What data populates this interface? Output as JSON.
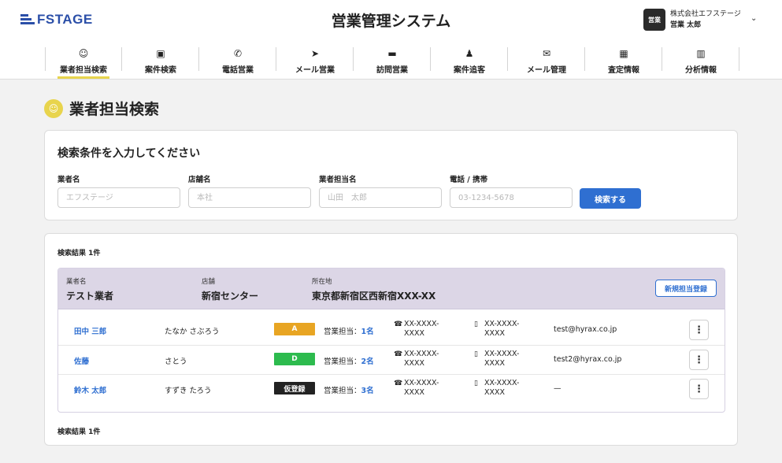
{
  "header": {
    "logo_text": "FSTAGE",
    "app_title": "営業管理システム",
    "user": {
      "avatar_label": "営業",
      "company": "株式会社エフステージ",
      "role": "営業 太郎"
    }
  },
  "nav": {
    "items": [
      {
        "label": "業者担当検索",
        "icon": "user-search-icon",
        "glyph": "☺",
        "active": true
      },
      {
        "label": "案件検索",
        "icon": "case-search-icon",
        "glyph": "▣"
      },
      {
        "label": "電話営業",
        "icon": "phone-icon",
        "glyph": "✆"
      },
      {
        "label": "メール営業",
        "icon": "send-icon",
        "glyph": "➤"
      },
      {
        "label": "訪問営業",
        "icon": "briefcase-icon",
        "glyph": "▬"
      },
      {
        "label": "案件追客",
        "icon": "walking-icon",
        "glyph": "♟"
      },
      {
        "label": "メール管理",
        "icon": "mail-icon",
        "glyph": "✉"
      },
      {
        "label": "査定情報",
        "icon": "calculator-icon",
        "glyph": "▦"
      },
      {
        "label": "分析情報",
        "icon": "chart-icon",
        "glyph": "▥"
      }
    ]
  },
  "page": {
    "title": "業者担当検索"
  },
  "search": {
    "title": "検索条件を入力してください",
    "fields": [
      {
        "label": "業者名",
        "placeholder": "エフステージ"
      },
      {
        "label": "店舗名",
        "placeholder": "本社"
      },
      {
        "label": "業者担当名",
        "placeholder": "山田　太郎"
      },
      {
        "label": "電話 / 携帯",
        "placeholder": "03-1234-5678"
      }
    ],
    "button_label": "検索する"
  },
  "results": {
    "count_label": "検索結果 1件",
    "company": {
      "name_label": "業者名",
      "name": "テスト業者",
      "store_label": "店舗",
      "store": "新宿センター",
      "address_label": "所在地",
      "address": "東京都新宿区西新宿XXX-XX",
      "register_button": "新規担当登録"
    },
    "staff": [
      {
        "name": "田中 三郎",
        "kana": "たなか さぶろう",
        "badge": "A",
        "badge_color": "#e8a523",
        "assign_label": "営業担当：",
        "assign_count": "1名",
        "tel": "XX-XXXX-XXXX",
        "mobile": "XX-XXXX-XXXX",
        "email": "test@hyrax.co.jp"
      },
      {
        "name": "佐藤",
        "kana": "さとう",
        "badge": "D",
        "badge_color": "#2dbb4e",
        "assign_label": "営業担当：",
        "assign_count": "2名",
        "tel": "XX-XXXX-XXXX",
        "mobile": "XX-XXXX-XXXX",
        "email": "test2@hyrax.co.jp"
      },
      {
        "name": "鈴木 太郎",
        "kana": "すずき たろう",
        "badge": "仮登録",
        "badge_color": "#222222",
        "assign_label": "営業担当：",
        "assign_count": "3名",
        "tel": "XX-XXXX-XXXX",
        "mobile": "XX-XXXX-XXXX",
        "email": "—"
      }
    ]
  }
}
